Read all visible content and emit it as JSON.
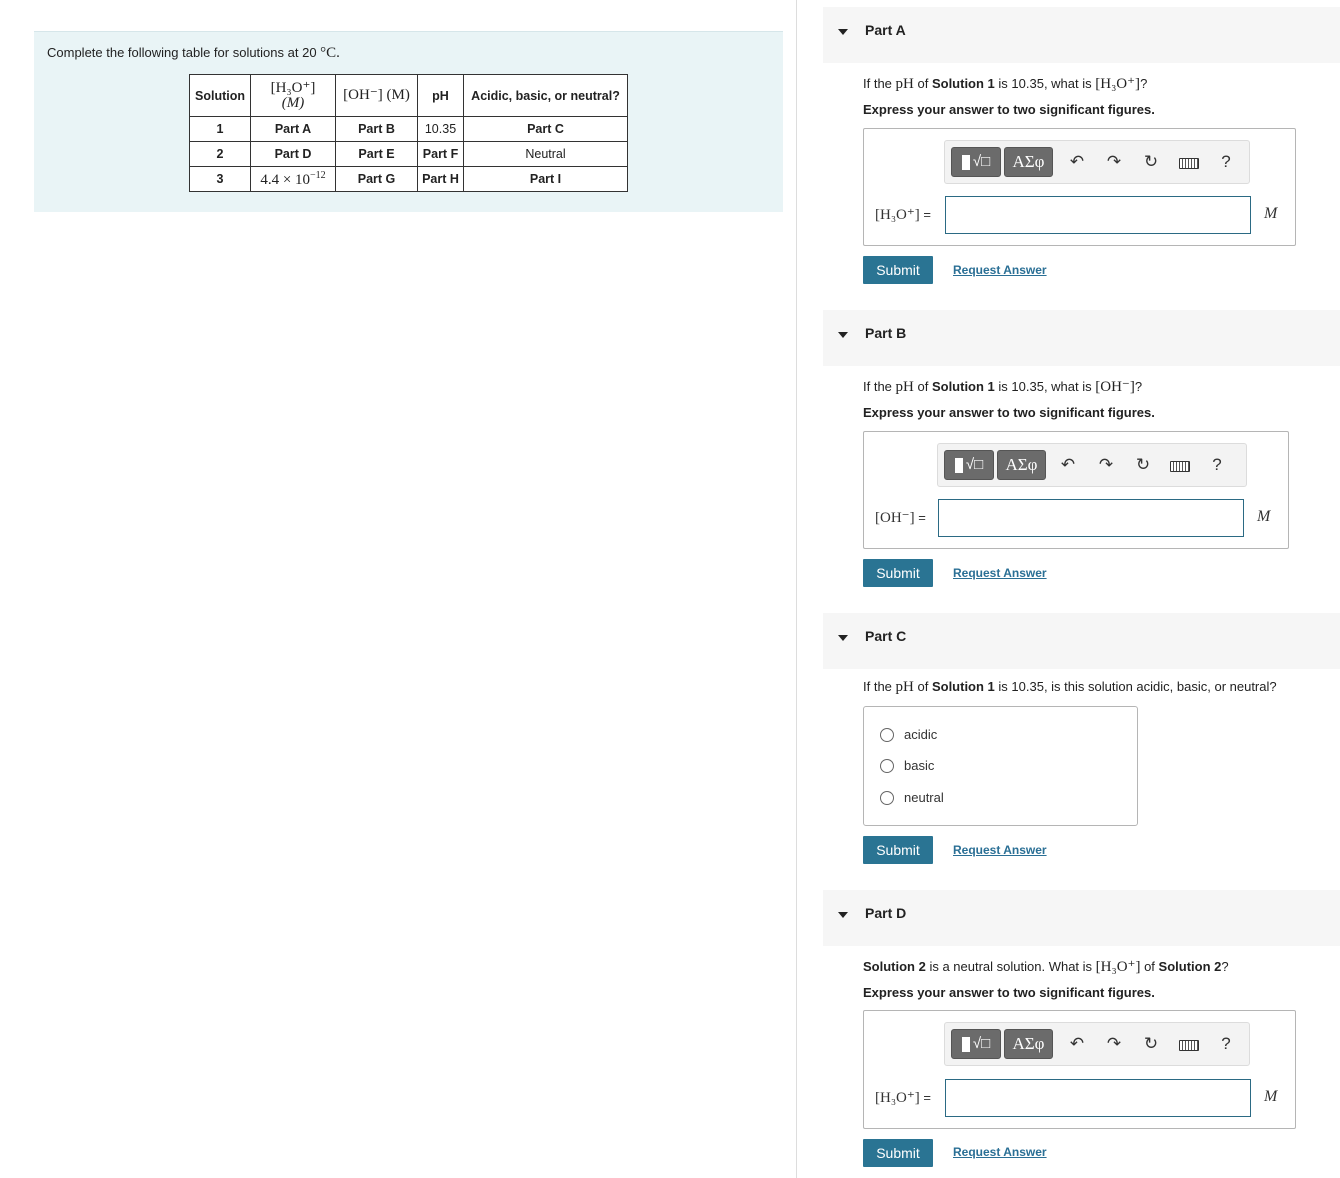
{
  "intro": {
    "text_pre": "Complete the following table for solutions at 20 ",
    "temp_unit": "°C."
  },
  "table": {
    "headers": {
      "solution": "Solution",
      "h3o": "[H₃O⁺]",
      "h3o_unit": "(M)",
      "oh": "[OH⁻] (M)",
      "ph": "pH",
      "nature": "Acidic, basic, or neutral?"
    },
    "rows": [
      {
        "solution": "1",
        "h3o": "Part A",
        "oh": "Part B",
        "ph": "10.35",
        "nature": "Part C"
      },
      {
        "solution": "2",
        "h3o": "Part D",
        "oh": "Part E",
        "ph": "Part F",
        "nature": "Neutral"
      },
      {
        "solution": "3",
        "h3o_mantissa": "4.4 × 10",
        "h3o_exp": "−12",
        "oh": "Part G",
        "ph": "Part H",
        "nature": "Part I"
      }
    ]
  },
  "toolbar": {
    "template_label": "√□",
    "greek_label": "ΑΣφ",
    "undo": "↶",
    "redo": "↷",
    "reset": "↻",
    "help": "?"
  },
  "parts": [
    {
      "title": "Part A",
      "q_pre": "If the ",
      "q_ph": "pH",
      "q_mid": " of ",
      "q_bold": "Solution 1",
      "q_post": " is 10.35, what is ",
      "q_math": "[H₃O⁺]",
      "q_end": "?",
      "sig": "Express your answer to two significant figures.",
      "label": "[H₃O⁺]",
      "eq": " =",
      "value": "",
      "unit": "M",
      "submit": "Submit",
      "request": "Request Answer"
    },
    {
      "title": "Part B",
      "q_pre": "If the ",
      "q_ph": "pH",
      "q_mid": " of ",
      "q_bold": "Solution 1",
      "q_post": " is 10.35, what is ",
      "q_math": "[OH⁻]",
      "q_end": "?",
      "sig": "Express your answer to two significant figures.",
      "label": "[OH⁻]",
      "eq": " =",
      "value": "",
      "unit": "M",
      "submit": "Submit",
      "request": "Request Answer"
    },
    {
      "title": "Part C",
      "q_pre": "If the ",
      "q_ph": "pH",
      "q_mid": " of ",
      "q_bold": "Solution 1",
      "q_post": " is 10.35, is this solution acidic, basic, or neutral?",
      "options": [
        "acidic",
        "basic",
        "neutral"
      ],
      "submit": "Submit",
      "request": "Request Answer"
    },
    {
      "title": "Part D",
      "q_bold": "Solution 2",
      "q_pre": " is a neutral solution. What is ",
      "q_math": "[H₃O⁺]",
      "q_mid": " of ",
      "q_bold2": "Solution 2",
      "q_end": "?",
      "sig": "Express your answer to two significant figures.",
      "label": "[H₃O⁺]",
      "eq": " =",
      "value": "",
      "unit": "M",
      "submit": "Submit",
      "request": "Request Answer"
    }
  ]
}
